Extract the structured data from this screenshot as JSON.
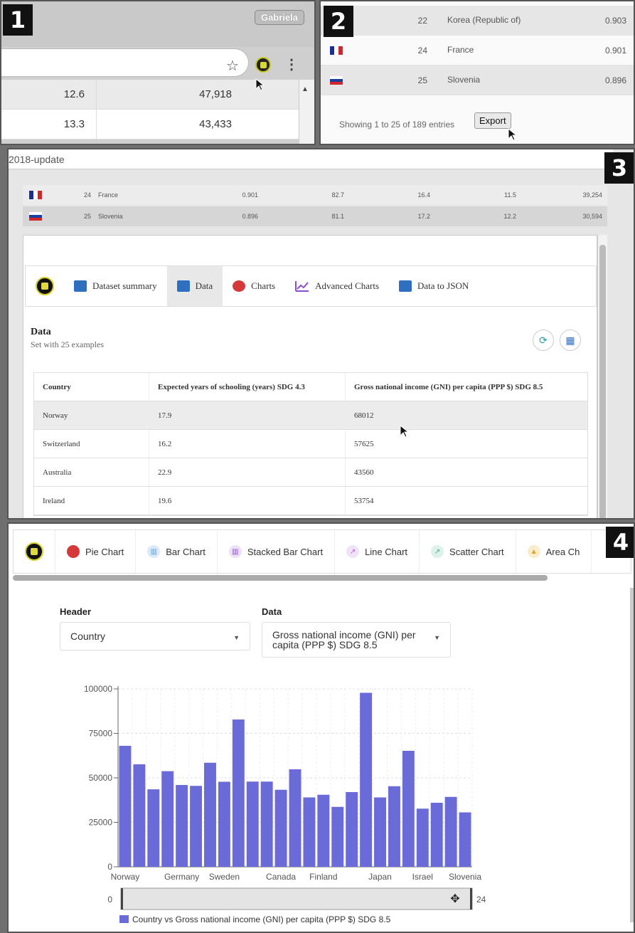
{
  "badges": [
    "1",
    "2",
    "3",
    "4"
  ],
  "panel1": {
    "profile": "Gabriela",
    "rows": [
      {
        "a": "12.6",
        "b": "47,918"
      },
      {
        "a": "13.3",
        "b": "43,433"
      }
    ]
  },
  "panel2": {
    "rows": [
      {
        "flag": "",
        "rank": "22",
        "country": "Korea (Republic of)",
        "hdi": "0.903"
      },
      {
        "flag": "france-flag",
        "rank": "24",
        "country": "France",
        "hdi": "0.901"
      },
      {
        "flag": "slovenia-flag",
        "rank": "25",
        "country": "Slovenia",
        "hdi": "0.896"
      }
    ],
    "footer": "Showing 1 to 25 of 189 entries",
    "export_label": "Export"
  },
  "panel3": {
    "url_fragment": "2018-update",
    "bg_rows": [
      {
        "rank": "24",
        "country": "France",
        "v1": "0.901",
        "v2": "82.7",
        "v3": "16.4",
        "v4": "11.5",
        "v5": "39,254"
      },
      {
        "rank": "25",
        "country": "Slovenia",
        "v1": "0.896",
        "v2": "81.1",
        "v3": "17.2",
        "v4": "12.2",
        "v5": "30,594"
      }
    ],
    "tabs": [
      {
        "label": "Dataset summary",
        "icon": "table-summary-icon",
        "color": "#2f6fbf"
      },
      {
        "label": "Data",
        "icon": "table-icon",
        "color": "#2f6fbf"
      },
      {
        "label": "Charts",
        "icon": "pie-chart-icon",
        "color": "#d53a3a"
      },
      {
        "label": "Advanced Charts",
        "icon": "line-chart-icon",
        "color": "#8a4fd0"
      },
      {
        "label": "Data to JSON",
        "icon": "json-icon",
        "color": "#2f6fbf"
      }
    ],
    "data_title": "Data",
    "data_subtitle": "Set with 25 examples",
    "columns": [
      "Country",
      "Expected years of schooling (years) SDG 4.3",
      "Gross national income (GNI) per capita (PPP $) SDG 8.5"
    ],
    "rows": [
      [
        "Norway",
        "17.9",
        "68012"
      ],
      [
        "Switzerland",
        "16.2",
        "57625"
      ],
      [
        "Australia",
        "22.9",
        "43560"
      ],
      [
        "Ireland",
        "19.6",
        "53754"
      ]
    ]
  },
  "panel4": {
    "tabs": [
      {
        "label": "Pie Chart",
        "color": "#d53a3a"
      },
      {
        "label": "Bar Chart",
        "color": "#5aa0d8"
      },
      {
        "label": "Stacked Bar Chart",
        "color": "#8a4fd0"
      },
      {
        "label": "Line Chart",
        "color": "#b060c8"
      },
      {
        "label": "Scatter Chart",
        "color": "#3fae8a"
      },
      {
        "label": "Area Ch",
        "color": "#e0a020"
      }
    ],
    "header_label": "Header",
    "header_value": "Country",
    "data_label": "Data",
    "data_value": "Gross national income (GNI) per capita (PPP $) SDG 8.5",
    "range_start": "0",
    "range_end": "24"
  },
  "chart_data": {
    "type": "bar",
    "categories": [
      "Norway",
      "",
      "",
      "Germany",
      "",
      "Sweden",
      "",
      "",
      "",
      "Canada",
      "",
      "Finland",
      "",
      "",
      "",
      "Japan",
      "",
      "",
      "Israel",
      "",
      "Slovenia"
    ],
    "values": [
      68012,
      57625,
      43560,
      53754,
      46000,
      45500,
      58500,
      47800,
      82800,
      47900,
      47900,
      43300,
      54800,
      39000,
      40500,
      33700,
      42000,
      97800,
      39000,
      45300,
      65200,
      32700,
      36000,
      39300,
      30594
    ],
    "ylim": [
      0,
      100000
    ],
    "yticks": [
      "100000",
      "75000",
      "50000",
      "25000",
      "0"
    ],
    "xtick_labels": [
      "Norway",
      "Germany",
      "Sweden",
      "Canada",
      "Finland",
      "Japan",
      "Israel",
      "Slovenia"
    ],
    "legend": "Country vs Gross national income (GNI) per capita (PPP $) SDG 8.5",
    "bar_color": "#6a6ad8",
    "grid": true
  }
}
